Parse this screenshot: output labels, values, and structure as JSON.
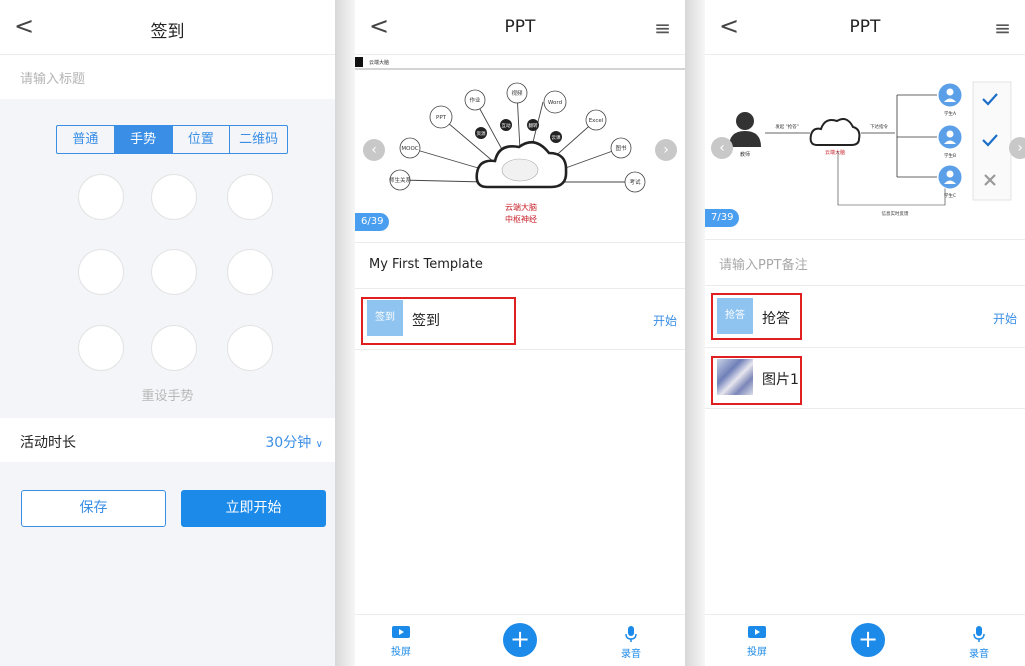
{
  "panel1": {
    "nav": {
      "back": "<",
      "title": "签到"
    },
    "title_placeholder": "请输入标题",
    "tabs": [
      "普通",
      "手势",
      "位置",
      "二维码"
    ],
    "active_tab": "手势",
    "reset": "重设手势",
    "duration_label": "活动时长",
    "duration_value": "30分钟",
    "save": "保存",
    "start": "立即开始"
  },
  "panel2": {
    "nav": {
      "back": "<",
      "title": "PPT",
      "menu": "≡"
    },
    "slide": {
      "header": "云端大脑",
      "counter": "6/39",
      "center_line1": "云端大脑",
      "center_line2": "中枢神经",
      "nodes": [
        "作业",
        "视频",
        "Word",
        "PPT",
        "Excel",
        "MOOC",
        "图书",
        "师生关系",
        "考试"
      ],
      "inner_nodes": [
        "资源",
        "互动",
        "翻转",
        "云课"
      ]
    },
    "note": "My First Template",
    "item": {
      "thumb": "签到",
      "label": "签到",
      "action": "开始"
    },
    "bottom": {
      "cast": "投屏",
      "record": "录音",
      "add": "+"
    }
  },
  "panel3": {
    "nav": {
      "back": "<",
      "title": "PPT",
      "menu": "≡"
    },
    "slide": {
      "counter": "7/39",
      "teacher": "教师",
      "send_label": "发起 \"抢答\"",
      "cloud_label": "云端大脑",
      "push_label": "下达指令",
      "students": [
        "学生A",
        "学生B",
        "学生C"
      ],
      "footer": "信息实时反馈"
    },
    "note_placeholder": "请输入PPT备注",
    "item1": {
      "thumb": "抢答",
      "label": "抢答",
      "action": "开始"
    },
    "item2": {
      "label": "图片1"
    },
    "bottom": {
      "cast": "投屏",
      "record": "录音",
      "add": "+"
    }
  },
  "colors": {
    "accent": "#1c8ae8",
    "highlight": "#e02020"
  }
}
